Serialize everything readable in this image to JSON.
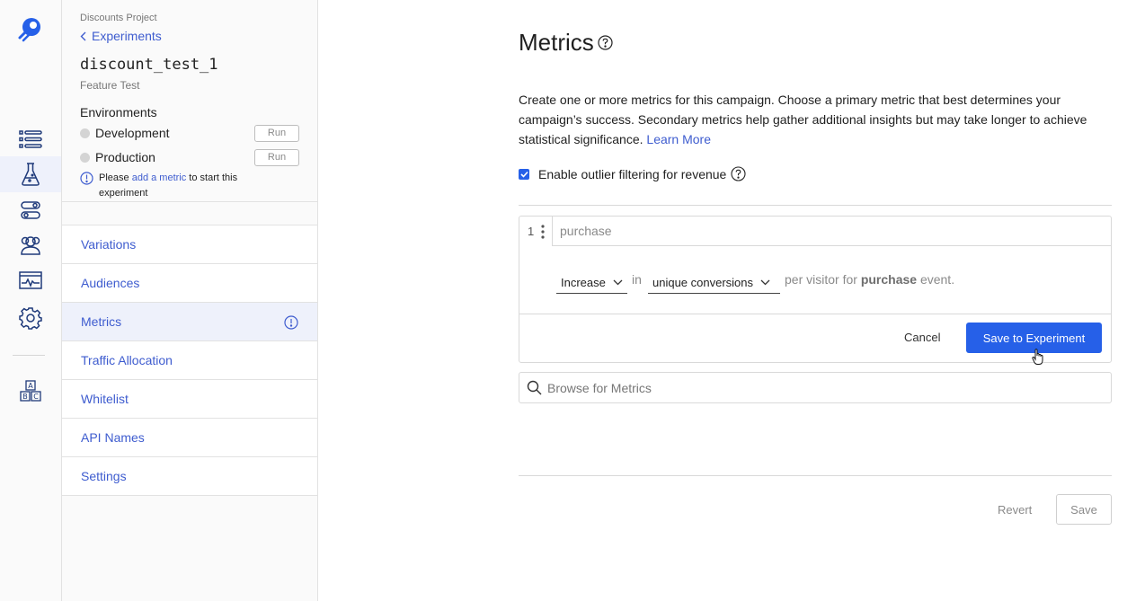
{
  "rail": {
    "items": [
      {
        "icon": "list-icon"
      },
      {
        "icon": "flask-icon",
        "active": true
      },
      {
        "icon": "toggles-icon"
      },
      {
        "icon": "audience-icon"
      },
      {
        "icon": "dashboard-icon"
      },
      {
        "icon": "gear-icon"
      },
      {
        "icon": "abc-blocks-icon"
      }
    ]
  },
  "sidebar": {
    "project": "Discounts Project",
    "back_label": "Experiments",
    "experiment_name": "discount_test_1",
    "experiment_type": "Feature Test",
    "environments_heading": "Environments",
    "environments": [
      {
        "name": "Development",
        "action": "Run"
      },
      {
        "name": "Production",
        "action": "Run"
      }
    ],
    "warning": {
      "pre": "Please ",
      "link": "add a metric",
      "post": " to start this experiment"
    },
    "nav": [
      {
        "label": "Variations"
      },
      {
        "label": "Audiences"
      },
      {
        "label": "Metrics",
        "active": true
      },
      {
        "label": "Traffic Allocation"
      },
      {
        "label": "Whitelist"
      },
      {
        "label": "API Names"
      },
      {
        "label": "Settings"
      }
    ]
  },
  "main": {
    "title": "Metrics",
    "description": "Create one or more metrics for this campaign. Choose a primary metric that best determines your campaign’s success. Secondary metrics help gather additional insights but may take longer to achieve statistical significance. ",
    "learn_more": "Learn More",
    "outlier_label": "Enable outlier filtering for revenue",
    "outlier_checked": true,
    "metric": {
      "index": "1",
      "name_placeholder": "purchase",
      "direction": "Increase",
      "in_text": "in",
      "aggregation": "unique conversions",
      "per_text": "per visitor for",
      "event": "purchase",
      "event_suffix": "event.",
      "cancel": "Cancel",
      "save": "Save to Experiment"
    },
    "browse_placeholder": "Browse for Metrics",
    "revert": "Revert",
    "save": "Save"
  },
  "colors": {
    "accent": "#2660e8",
    "link": "#3e5ccf",
    "active_bg": "#eef1fb"
  }
}
